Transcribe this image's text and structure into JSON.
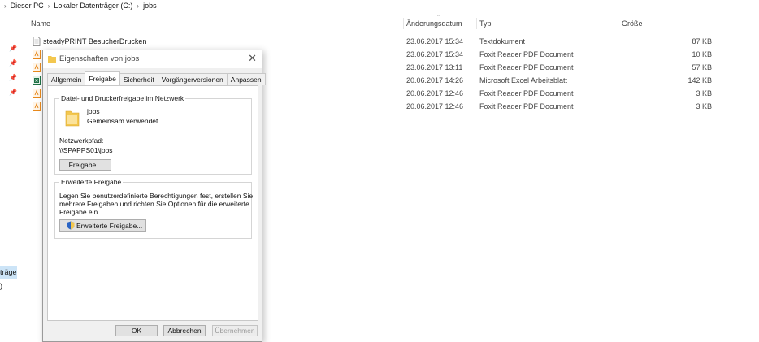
{
  "breadcrumb": [
    "Dieser PC",
    "Lokaler Datenträger (C:)",
    "jobs"
  ],
  "columns": {
    "name": "Name",
    "date": "Änderungsdatum",
    "type": "Typ",
    "size": "Größe"
  },
  "files": [
    {
      "name": "steadyPRINT BesucherDrucken",
      "date": "23.06.2017 15:34",
      "type": "Textdokument",
      "size": "87 KB",
      "icon": "text-file-icon"
    },
    {
      "name": "",
      "date": "23.06.2017 15:34",
      "type": "Foxit Reader PDF Document",
      "size": "10 KB",
      "icon": "pdf-file-icon"
    },
    {
      "name": "",
      "date": "23.06.2017 13:11",
      "type": "Foxit Reader PDF Document",
      "size": "57 KB",
      "icon": "pdf-file-icon"
    },
    {
      "name": "",
      "date": "20.06.2017 14:26",
      "type": "Microsoft Excel Arbeitsblatt",
      "size": "142 KB",
      "icon": "excel-file-icon"
    },
    {
      "name": "",
      "date": "20.06.2017 12:46",
      "type": "Foxit Reader PDF Document",
      "size": "3 KB",
      "icon": "pdf-file-icon"
    },
    {
      "name": "",
      "date": "20.06.2017 12:46",
      "type": "Foxit Reader PDF Document",
      "size": "3 KB",
      "icon": "pdf-file-icon"
    }
  ],
  "nav": {
    "selected_fragment": "träger",
    "paren_fragment": ")"
  },
  "dialog": {
    "title": "Eigenschaften von jobs",
    "tabs": [
      "Allgemein",
      "Freigabe",
      "Sicherheit",
      "Vorgängerversionen",
      "Anpassen"
    ],
    "active_tab": "Freigabe",
    "network_group": {
      "title": "Datei- und Druckerfreigabe im Netzwerk",
      "folder_name": "jobs",
      "folder_status": "Gemeinsam verwendet",
      "path_label": "Netzwerkpfad:",
      "path_value": "\\\\SPAPPS01\\jobs",
      "share_button": "Freigabe..."
    },
    "advanced_group": {
      "title": "Erweiterte Freigabe",
      "description_line1": "Legen Sie benutzerdefinierte Berechtigungen fest, erstellen Sie",
      "description_line2": "mehrere Freigaben und richten Sie Optionen für die erweiterte",
      "description_line3": "Freigabe ein.",
      "button": "Erweiterte Freigabe..."
    },
    "buttons": {
      "ok": "OK",
      "cancel": "Abbrechen",
      "apply": "Übernehmen"
    }
  },
  "colors": {
    "selection": "#cce4f7",
    "pdf_icon": "#e8891c",
    "excel_icon": "#1e7145",
    "folder": "#f3c74f"
  }
}
